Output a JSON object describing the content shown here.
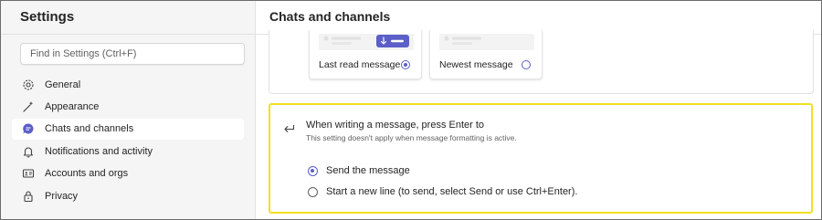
{
  "sidebar": {
    "title": "Settings",
    "search_placeholder": "Find in Settings (Ctrl+F)",
    "items": [
      {
        "label": "General",
        "icon": "gear-icon",
        "active": false
      },
      {
        "label": "Appearance",
        "icon": "magic-wand-icon",
        "active": false
      },
      {
        "label": "Chats and channels",
        "icon": "chat-bubble-icon",
        "active": true
      },
      {
        "label": "Notifications and activity",
        "icon": "bell-icon",
        "active": false
      },
      {
        "label": "Accounts and orgs",
        "icon": "id-card-icon",
        "active": false
      },
      {
        "label": "Privacy",
        "icon": "lock-icon",
        "active": false
      }
    ]
  },
  "main": {
    "title": "Chats and channels",
    "landing_options": [
      {
        "label": "Last read message",
        "selected": true
      },
      {
        "label": "Newest message",
        "selected": false
      }
    ],
    "enter_setting": {
      "title": "When writing a message, press Enter to",
      "subtitle": "This setting doesn't apply when message formatting is active.",
      "choices": [
        {
          "label": "Send the message",
          "selected": true
        },
        {
          "label": "Start a new line (to send, select Send or use Ctrl+Enter).",
          "selected": false
        }
      ]
    }
  },
  "colors": {
    "accent": "#5b5fc7",
    "highlight_border": "#f2e01f",
    "sidebar_bg": "#f5f5f5"
  }
}
